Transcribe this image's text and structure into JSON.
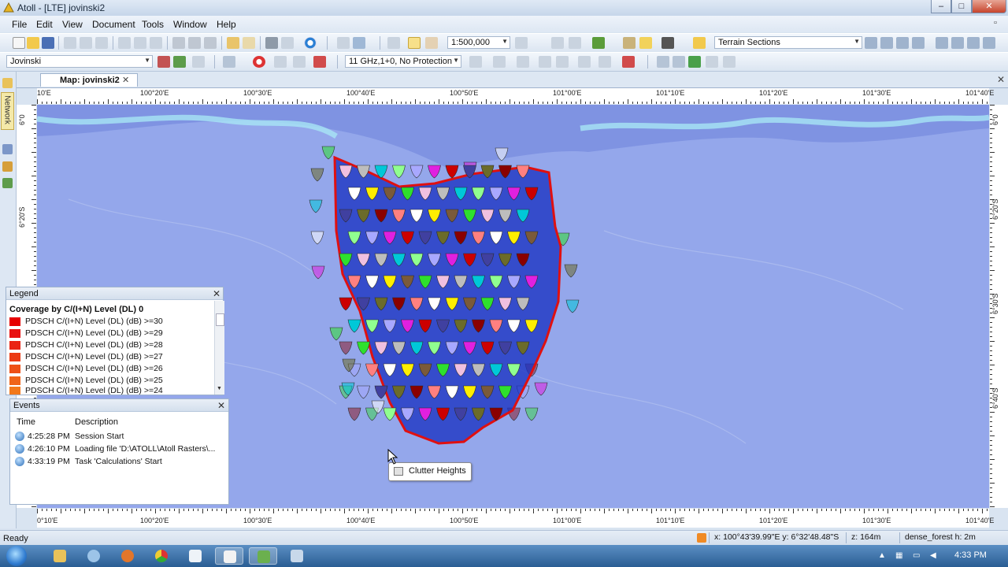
{
  "window": {
    "title": "Atoll - [LTE] jovinski2",
    "controls": {
      "minimize": "–",
      "maximize": "□",
      "close": "✕"
    }
  },
  "menu": [
    "File",
    "Edit",
    "View",
    "Document",
    "Tools",
    "Window",
    "Help"
  ],
  "toolbar1": {
    "scale_value": "1:500,000",
    "layer_combo": "Terrain Sections"
  },
  "toolbar2": {
    "project_combo": "Jovinski",
    "config_combo": "11 GHz,1+0, No Protection"
  },
  "sidebar": {
    "network_tab": "Network"
  },
  "document_tab": {
    "label": "Map: jovinski2",
    "close": "✕"
  },
  "rulers": {
    "top_labels": [
      "10'E",
      "100°20'E",
      "100°30'E",
      "100°40'E",
      "100°50'E",
      "101°00'E",
      "101°10'E",
      "101°20'E",
      "101°30'E",
      "101°40'E"
    ],
    "bottom_labels": [
      "0°10'E",
      "100°20'E",
      "100°30'E",
      "100°40'E",
      "100°50'E",
      "101°00'E",
      "101°10'E",
      "101°20'E",
      "101°30'E",
      "101°40'E"
    ],
    "left_labels": [
      "6°0",
      "6°20'S"
    ],
    "right_labels": [
      "6°0",
      "6°20'S",
      "6°30'S",
      "6°40'S"
    ]
  },
  "legend": {
    "title": "Legend",
    "subtitle": "Coverage by C/(I+N) Level (DL) 0",
    "close": "✕",
    "items": [
      {
        "label": "PDSCH C/(I+N) Level (DL) (dB) >=30",
        "color": "#e60000"
      },
      {
        "label": "PDSCH C/(I+N) Level (DL) (dB) >=29",
        "color": "#e81010"
      },
      {
        "label": "PDSCH C/(I+N) Level (DL) (dB) >=28",
        "color": "#ea2414"
      },
      {
        "label": "PDSCH C/(I+N) Level (DL) (dB) >=27",
        "color": "#ec3a14"
      },
      {
        "label": "PDSCH C/(I+N) Level (DL) (dB) >=26",
        "color": "#ee5016"
      },
      {
        "label": "PDSCH C/(I+N) Level (DL) (dB) >=25",
        "color": "#f06418"
      },
      {
        "label": "PDSCH C/(I+N) Level (DL) (dB) >=24",
        "color": "#f2781a"
      }
    ]
  },
  "events": {
    "title": "Events",
    "close": "✕",
    "columns": {
      "time": "Time",
      "description": "Description"
    },
    "rows": [
      {
        "time": "4:25:28 PM",
        "description": "Session Start"
      },
      {
        "time": "4:26:10 PM",
        "description": "Loading file 'D:\\ATOLL\\Atoll Rasters\\..."
      },
      {
        "time": "4:33:19 PM",
        "description": "Task 'Calculations' Start"
      }
    ]
  },
  "tooltip": {
    "text": "Clutter Heights"
  },
  "status": {
    "ready": "Ready",
    "coords": "x: 100°43'39.99\"E  y: 6°32'48.48\"S",
    "z": "z: 164m",
    "clutter": "dense_forest  h: 2m"
  },
  "taskbar": {
    "clock": "4:33 PM"
  },
  "colors": {
    "map_water": "#7f93e2",
    "land": "#93a6ea",
    "coverage_blue": "#1a2fbf",
    "boundary": "#e01010"
  }
}
